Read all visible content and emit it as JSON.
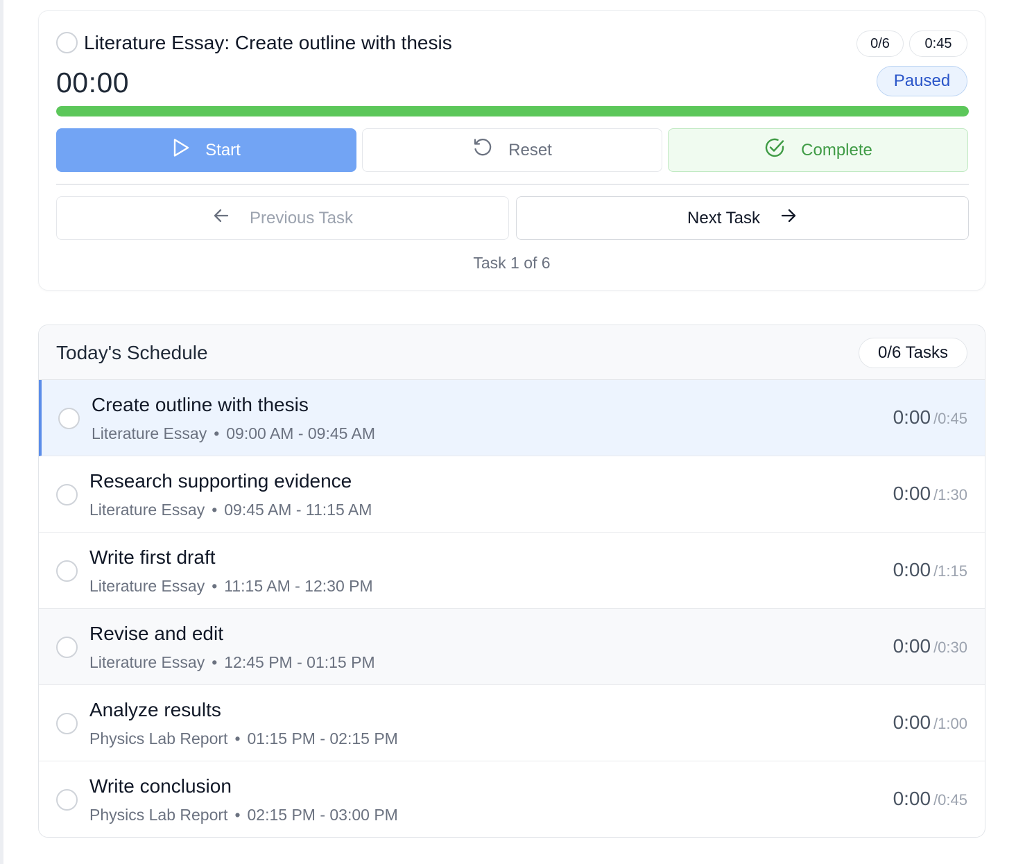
{
  "current_task": {
    "title": "Literature Essay: Create outline with thesis",
    "progress_count": "0/6",
    "duration": "0:45",
    "elapsed": "00:00",
    "status": "Paused",
    "progress_fraction": 1.0
  },
  "actions": {
    "start_label": "Start",
    "reset_label": "Reset",
    "complete_label": "Complete"
  },
  "navigation": {
    "previous_label": "Previous Task",
    "next_label": "Next Task",
    "counter": "Task 1 of 6"
  },
  "schedule": {
    "title": "Today's Schedule",
    "tasks_badge": "0/6 Tasks",
    "items": [
      {
        "title": "Create outline with thesis",
        "project": "Literature Essay",
        "time_range": "09:00 AM - 09:45 AM",
        "elapsed": "0:00",
        "total": "/0:45"
      },
      {
        "title": "Research supporting evidence",
        "project": "Literature Essay",
        "time_range": "09:45 AM - 11:15 AM",
        "elapsed": "0:00",
        "total": "/1:30"
      },
      {
        "title": "Write first draft",
        "project": "Literature Essay",
        "time_range": "11:15 AM - 12:30 PM",
        "elapsed": "0:00",
        "total": "/1:15"
      },
      {
        "title": "Revise and edit",
        "project": "Literature Essay",
        "time_range": "12:45 PM - 01:15 PM",
        "elapsed": "0:00",
        "total": "/0:30"
      },
      {
        "title": "Analyze results",
        "project": "Physics Lab Report",
        "time_range": "01:15 PM - 02:15 PM",
        "elapsed": "0:00",
        "total": "/1:00"
      },
      {
        "title": "Write conclusion",
        "project": "Physics Lab Report",
        "time_range": "02:15 PM - 03:00 PM",
        "elapsed": "0:00",
        "total": "/0:45"
      }
    ]
  },
  "icons": {
    "start": "play-icon",
    "reset": "rotate-ccw-icon",
    "complete": "check-circle-icon",
    "previous": "arrow-left-icon",
    "next": "arrow-right-icon"
  },
  "colors": {
    "accent": "#72a4f4",
    "progress": "#5cc75a",
    "complete": "#3f9b45",
    "status": "#2a55c9"
  }
}
